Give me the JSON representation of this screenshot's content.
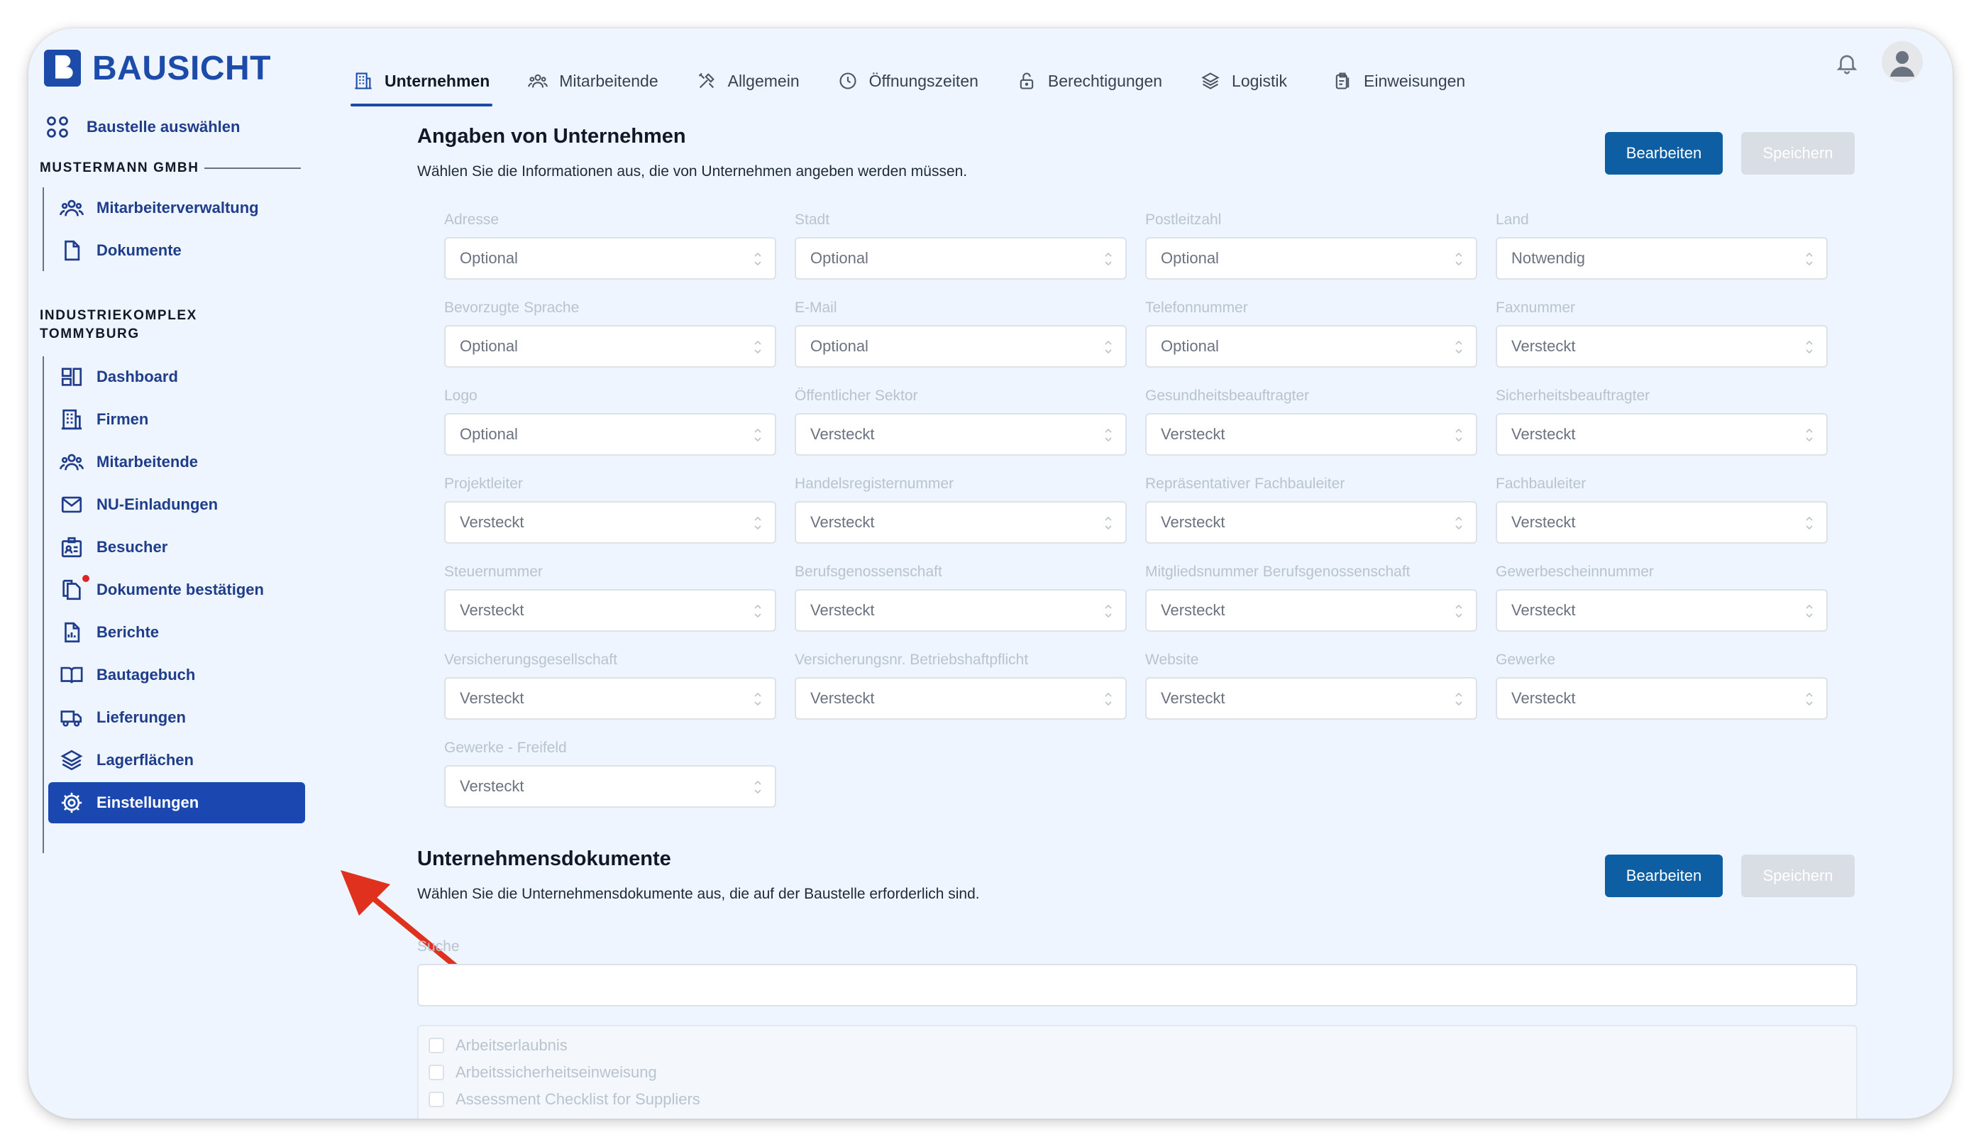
{
  "brand": {
    "name": "BAUSICHT"
  },
  "tabs": [
    {
      "label": "Unternehmen",
      "icon": "building-icon",
      "active": true
    },
    {
      "label": "Mitarbeitende",
      "icon": "users-icon",
      "active": false
    },
    {
      "label": "Allgemein",
      "icon": "tools-icon",
      "active": false
    },
    {
      "label": "Öffnungszeiten",
      "icon": "clock-icon",
      "active": false
    },
    {
      "label": "Berechtigungen",
      "icon": "lock-icon",
      "active": false
    },
    {
      "label": "Logistik",
      "icon": "layers-icon",
      "active": false
    },
    {
      "label": "Einweisungen",
      "icon": "clipboard-icon",
      "active": false
    }
  ],
  "sidebar": {
    "top_item": "Baustelle auswählen",
    "group1": {
      "label": "MUSTERMANN GMBH",
      "items": [
        "Mitarbeiterverwaltung",
        "Dokumente"
      ]
    },
    "group2": {
      "label_line1": "INDUSTRIEKOMPLEX",
      "label_line2": "TOMMYBURG",
      "items": [
        "Dashboard",
        "Firmen",
        "Mitarbeitende",
        "NU-Einladungen",
        "Besucher",
        "Dokumente bestätigen",
        "Berichte",
        "Bautagebuch",
        "Lieferungen",
        "Lagerflächen",
        "Einstellungen"
      ],
      "active": "Einstellungen"
    }
  },
  "company_section": {
    "title": "Angaben von Unternehmen",
    "description": "Wählen Sie die Informationen aus, die von Unternehmen angeben werden müssen.",
    "edit_label": "Bearbeiten",
    "save_label": "Speichern",
    "fields": [
      {
        "label": "Adresse",
        "value": "Optional"
      },
      {
        "label": "Stadt",
        "value": "Optional"
      },
      {
        "label": "Postleitzahl",
        "value": "Optional"
      },
      {
        "label": "Land",
        "value": "Notwendig"
      },
      {
        "label": "Bevorzugte Sprache",
        "value": "Optional"
      },
      {
        "label": "E-Mail",
        "value": "Optional"
      },
      {
        "label": "Telefonnummer",
        "value": "Optional"
      },
      {
        "label": "Faxnummer",
        "value": "Versteckt"
      },
      {
        "label": "Logo",
        "value": "Optional"
      },
      {
        "label": "Öffentlicher Sektor",
        "value": "Versteckt"
      },
      {
        "label": "Gesundheitsbeauftragter",
        "value": "Versteckt"
      },
      {
        "label": "Sicherheitsbeauftragter",
        "value": "Versteckt"
      },
      {
        "label": "Projektleiter",
        "value": "Versteckt"
      },
      {
        "label": "Handelsregisternummer",
        "value": "Versteckt"
      },
      {
        "label": "Repräsentativer Fachbauleiter",
        "value": "Versteckt"
      },
      {
        "label": "Fachbauleiter",
        "value": "Versteckt"
      },
      {
        "label": "Steuernummer",
        "value": "Versteckt"
      },
      {
        "label": "Berufsgenossenschaft",
        "value": "Versteckt"
      },
      {
        "label": "Mitgliedsnummer Berufsgenossenschaft",
        "value": "Versteckt"
      },
      {
        "label": "Gewerbescheinnummer",
        "value": "Versteckt"
      },
      {
        "label": "Versicherungsgesellschaft",
        "value": "Versteckt"
      },
      {
        "label": "Versicherungsnr. Betriebshaftpflicht",
        "value": "Versteckt"
      },
      {
        "label": "Website",
        "value": "Versteckt"
      },
      {
        "label": "Gewerke",
        "value": "Versteckt"
      },
      {
        "label": "Gewerke - Freifeld",
        "value": "Versteckt"
      }
    ]
  },
  "documents_section": {
    "title": "Unternehmensdokumente",
    "description": "Wählen Sie die Unternehmensdokumente aus, die auf der Baustelle erforderlich sind.",
    "edit_label": "Bearbeiten",
    "save_label": "Speichern",
    "search_label": "Suche",
    "search_value": "",
    "documents": [
      "Arbeitserlaubnis",
      "Arbeitssicherheitseinweisung",
      "Assessment Checklist for Suppliers"
    ]
  },
  "colors": {
    "brand": "#1d4ba9",
    "primary_button": "#0d5ea3",
    "sidebar_active": "#1a47b0",
    "annotation_arrow": "#e0301e",
    "notification_dot": "#dc2626"
  }
}
